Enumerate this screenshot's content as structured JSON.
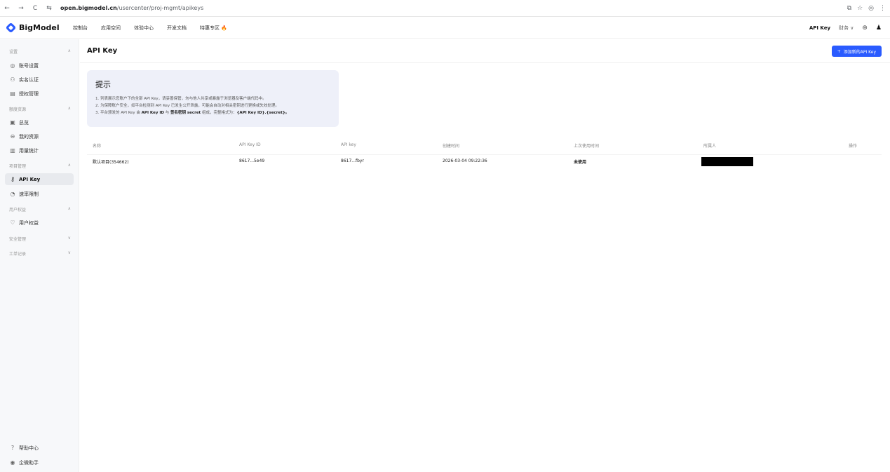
{
  "browser": {
    "back": "←",
    "forward": "→",
    "reload": "C",
    "tune": "⇆",
    "url_domain": "open.bigmodel.cn",
    "url_path": "/usercenter/proj-mgmt/apikeys",
    "right_icons": [
      "⧉",
      "☆",
      "◎",
      "⋮"
    ]
  },
  "header": {
    "logo_text": "BigModel",
    "nav": [
      "控制台",
      "应用空间",
      "体验中心",
      "开发文档",
      "特惠专区 🔥"
    ],
    "api_key": "API Key",
    "finance": "财务 ∨",
    "globe": "⊕",
    "user": "♟"
  },
  "sidebar": {
    "groups": [
      {
        "label": "设置",
        "chevron": "∧"
      },
      {
        "label": "额度资源",
        "chevron": "∧"
      },
      {
        "label": "项目管理",
        "chevron": "∧"
      },
      {
        "label": "用户权益",
        "chevron": "∧"
      },
      {
        "label": "安全管理",
        "chevron": "∨"
      },
      {
        "label": "工单记录",
        "chevron": "∨"
      }
    ],
    "items": [
      {
        "label": "账号设置",
        "icon": "◎"
      },
      {
        "label": "实名认证",
        "icon": "⚇"
      },
      {
        "label": "授权管理",
        "icon": "▤"
      },
      {
        "label": "总览",
        "icon": "▣"
      },
      {
        "label": "我的资源",
        "icon": "⊖"
      },
      {
        "label": "用量统计",
        "icon": "▥"
      },
      {
        "label": "API Key",
        "icon": "⚷"
      },
      {
        "label": "速率限制",
        "icon": "◔"
      },
      {
        "label": "用户权益",
        "icon": "♡"
      },
      {
        "label": "帮助中心",
        "icon": "?"
      },
      {
        "label": "企微助手",
        "icon": "◉"
      }
    ]
  },
  "main": {
    "title": "API Key",
    "add_button": "添加新的API Key",
    "add_icon": "+",
    "tip": {
      "title": "提示",
      "line1": "1. 列表展示您账户下的全部 API Key，请妥善保管，勿与他人共享或暴露于浏览器及客户端代码中。",
      "line2": "2. 为保障账户安全，如平台检测到 API Key 已发生公开泄露，可能会自动对相关密钥进行更换或失效处理。",
      "line3_pre": "3. 平台颁发的 API Key 由 ",
      "line3_b1": "API Key ID",
      "line3_mid": " 与 ",
      "line3_b2": "签名密钥 secret",
      "line3_post": " 组成，完整格式为：",
      "line3_b3": "{API Key ID}.{secret}。"
    },
    "table": {
      "headers": [
        "名称",
        "API Key ID",
        "API key",
        "创建时间",
        "上次使用时间",
        "所属人",
        "操作"
      ],
      "rows": [
        {
          "name": "默认项目(354662)",
          "key_id": "8617...5e49",
          "api_key": "8617...fbyr",
          "created": "2026-03-04 09:22:36",
          "last_used": "未使用"
        }
      ]
    }
  }
}
